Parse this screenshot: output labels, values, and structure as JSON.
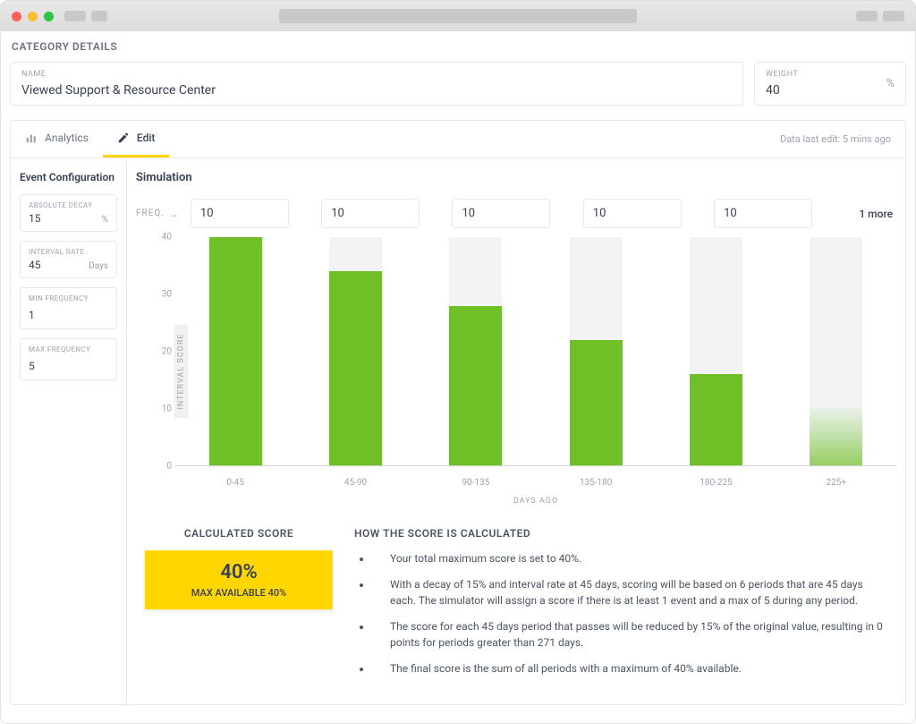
{
  "section_title": "CATEGORY DETAILS",
  "name_field": {
    "label": "NAME",
    "value": "Viewed Support & Resource Center"
  },
  "weight_field": {
    "label": "WEIGHT",
    "value": "40",
    "unit": "%"
  },
  "tabs": {
    "analytics": "Analytics",
    "edit": "Edit"
  },
  "last_edit": "Data last edit: 5 mins ago",
  "sidebar": {
    "title": "Event Configuration",
    "absolute_decay": {
      "label": "ABSOLUTE DECAY",
      "value": "15",
      "unit": "%"
    },
    "interval_rate": {
      "label": "INTERVAL RATE",
      "value": "45",
      "unit": "Days"
    },
    "min_frequency": {
      "label": "MIN FREQUENCY",
      "value": "1"
    },
    "max_frequency": {
      "label": "MAX FREQUENCY",
      "value": "5"
    }
  },
  "simulation": {
    "title": "Simulation",
    "freq_label": "FREQ.",
    "freq_values": [
      "10",
      "10",
      "10",
      "10",
      "10"
    ],
    "freq_more": "1 more"
  },
  "chart_data": {
    "type": "bar",
    "categories": [
      "0-45",
      "45-90",
      "90-135",
      "135-180",
      "180-225",
      "225+"
    ],
    "values": [
      40,
      34,
      28,
      22,
      16,
      10
    ],
    "series_fade": [
      false,
      false,
      false,
      false,
      false,
      true
    ],
    "title": "",
    "xlabel": "DAYS AGO",
    "ylabel": "INTERVAL SCORE",
    "ylim": [
      0,
      40
    ],
    "yticks": [
      0,
      10,
      20,
      30,
      40
    ]
  },
  "score": {
    "title": "CALCULATED SCORE",
    "big": "40%",
    "sub": "MAX AVAILABLE 40%"
  },
  "explain": {
    "title": "HOW THE SCORE IS CALCULATED",
    "bullets": [
      "Your total maximum score is set to 40%.",
      "With a decay of 15% and interval rate at 45 days, scoring will be based on 6 periods that are 45 days each. The simulator will assign a score if there is at least 1 event and a max of 5 during any period.",
      "The score for each 45 days period that passes will be reduced by 15% of the original value, resulting in 0 points for periods greater than 271 days.",
      "The final score is the sum of all periods with a maximum of 40% available."
    ]
  }
}
